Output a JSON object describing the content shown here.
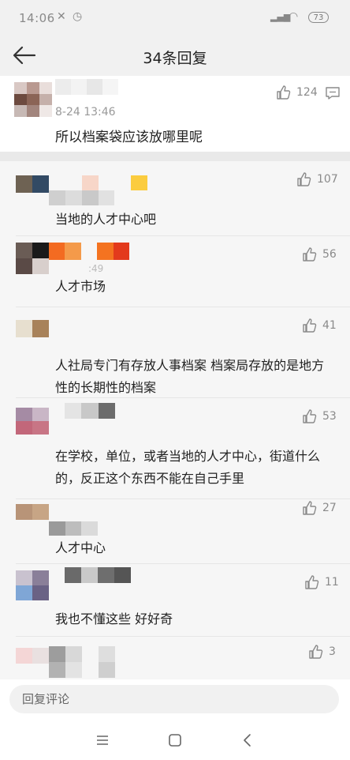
{
  "status_bar": {
    "time": "14:06",
    "battery": "73"
  },
  "header": {
    "title": "34条回复",
    "back_icon": "back-arrow-icon"
  },
  "main_comment": {
    "timestamp": "8-24 13:46",
    "text": "所以档案袋应该放哪里呢",
    "likes": "124",
    "more_icon": "comment-icon"
  },
  "replies": [
    {
      "text": "当地的人才中心吧",
      "likes": "107"
    },
    {
      "time_fragment": ":49",
      "text": "人才市场",
      "likes": "56"
    },
    {
      "text": "人社局专门有存放人事档案  档案局存放的是地方性的长期性的档案",
      "likes": "41"
    },
    {
      "text": "在学校，单位，或者当地的人才中心，街道什么的，反正这个东西不能在自己手里",
      "likes": "53"
    },
    {
      "text": "人才中心",
      "likes": "27"
    },
    {
      "text": "我也不懂这些  好好奇",
      "likes": "11"
    },
    {
      "text": "",
      "likes": "3"
    }
  ],
  "reply_bar": {
    "placeholder": "回复评论"
  },
  "colors": {
    "page_bg": "#eeeeee",
    "card_bg": "#ffffff",
    "muted_text": "#8a8a8a",
    "main_text": "#222222"
  }
}
